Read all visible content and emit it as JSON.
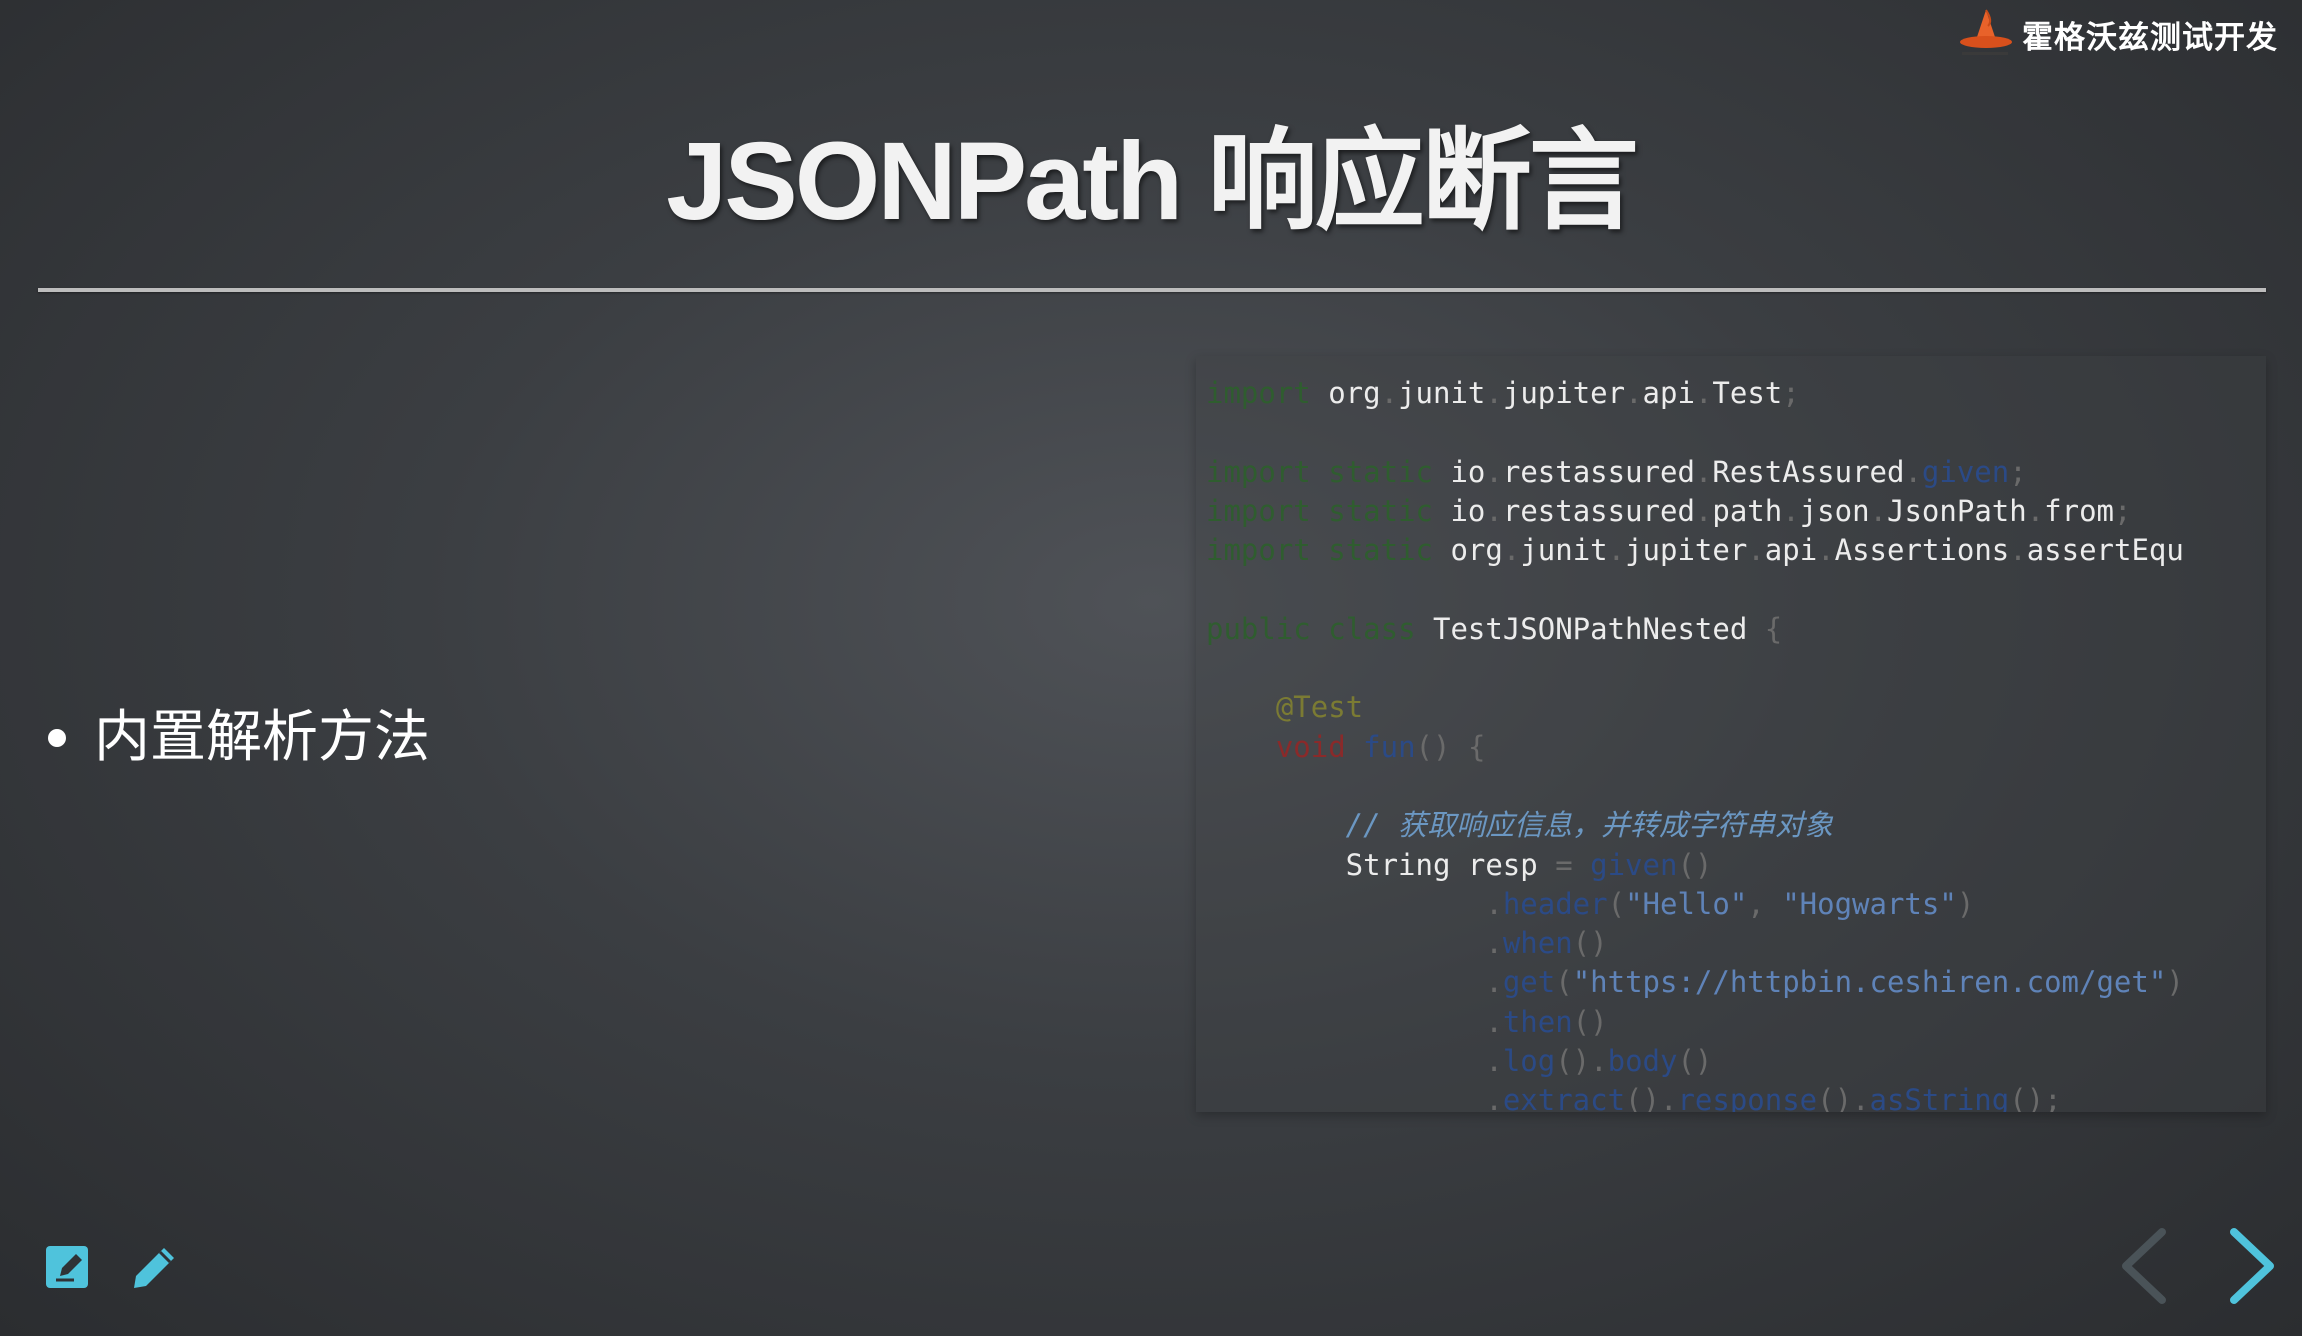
{
  "brand": {
    "name": "霍格沃兹测试开发"
  },
  "slide": {
    "title": "JSONPath 响应断言",
    "bullet": "内置解析方法"
  },
  "code": {
    "language": "java",
    "lines": [
      "import org.junit.jupiter.api.Test;",
      "",
      "import static io.restassured.RestAssured.given;",
      "import static io.restassured.path.json.JsonPath.from;",
      "import static org.junit.jupiter.api.Assertions.assertEqu",
      "",
      "public class TestJSONPathNested {",
      "",
      "    @Test",
      "    void fun() {",
      "",
      "        // 获取响应信息，并转成字符串对象",
      "        String resp = given()",
      "                .header(\"Hello\", \"Hogwarts\")",
      "                .when()",
      "                .get(\"https://httpbin.ceshiren.com/get\")",
      "                .then()",
      "                .log().body()",
      "                .extract().response().asString();"
    ]
  },
  "toolbar": {
    "edit_icon": "edit-note-icon",
    "pencil_icon": "pencil-icon"
  },
  "navigation": {
    "prev_icon": "chevron-left-icon",
    "next_icon": "chevron-right-icon"
  },
  "colors": {
    "accent": "#4fc3dc",
    "brand_orange": "#e8622a"
  }
}
